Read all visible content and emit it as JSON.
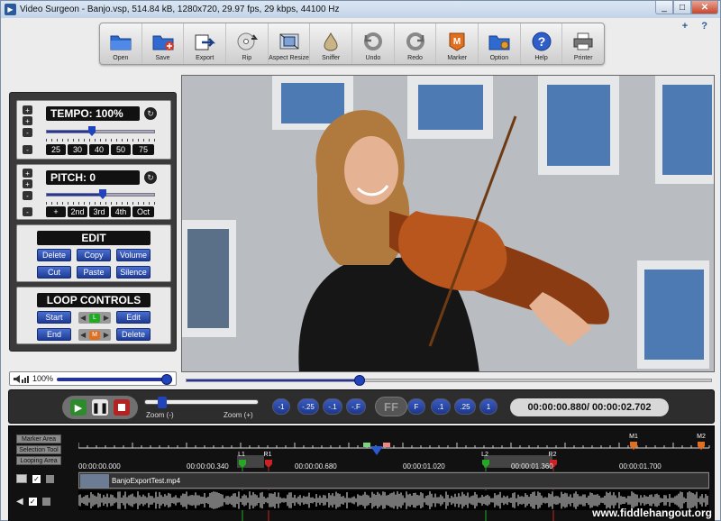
{
  "window": {
    "title": "Video Surgeon - Banjo.vsp, 514.84 kB, 1280x720, 29.97 fps, 29 kbps, 44100 Hz",
    "help_links": "+ ?"
  },
  "toolbar": {
    "items": [
      {
        "label": "Open",
        "icon": "open-folder-icon"
      },
      {
        "label": "Save",
        "icon": "save-icon"
      },
      {
        "label": "Export",
        "icon": "export-icon"
      },
      {
        "label": "Rip",
        "icon": "rip-disc-icon"
      },
      {
        "label": "Aspect Resize",
        "icon": "aspect-resize-icon"
      },
      {
        "label": "Sniffer",
        "icon": "sniffer-icon"
      },
      {
        "label": "Undo",
        "icon": "undo-icon"
      },
      {
        "label": "Redo",
        "icon": "redo-icon"
      },
      {
        "label": "Marker",
        "icon": "marker-icon"
      },
      {
        "label": "Option",
        "icon": "option-icon"
      },
      {
        "label": "Help",
        "icon": "help-icon"
      },
      {
        "label": "Printer",
        "icon": "printer-icon"
      }
    ]
  },
  "tempo": {
    "label": "TEMPO: 100%",
    "level": 0.42,
    "presets": [
      "25",
      "30",
      "40",
      "50",
      "75"
    ]
  },
  "pitch": {
    "label": "PITCH: 0",
    "level": 0.52,
    "presets": [
      "+",
      "2nd",
      "3rd",
      "4th",
      "Oct"
    ]
  },
  "edit": {
    "header": "EDIT",
    "buttons": [
      "Delete",
      "Copy",
      "Volume",
      "Cut",
      "Paste",
      "Silence"
    ]
  },
  "loop": {
    "header": "LOOP CONTROLS",
    "start": "Start",
    "end": "End",
    "edit": "Edit",
    "delete": "Delete",
    "start_mark": "L",
    "end_mark": "M"
  },
  "volume": {
    "label": "100%",
    "level": 1.0
  },
  "video": {
    "progress": 0.33
  },
  "transport": {
    "zoom_minus": "Zoom (-)",
    "zoom_plus": "Zoom (+)",
    "speeds": [
      "-1",
      "-.25",
      "-.1",
      "-.F",
      "F",
      ".1",
      ".25",
      "1"
    ],
    "ff": "FF",
    "time": "00:00:00.880/ 00:00:02.702"
  },
  "timeline": {
    "rows": [
      "Marker Area",
      "Selection Tool",
      "Looping Area"
    ],
    "markers": [
      "L1",
      "R1",
      "L2",
      "R2",
      "M1",
      "M2"
    ],
    "timecodes": [
      "00:00:00.000",
      "00:00:00.340",
      "00:00:00.680",
      "00:00:01.020",
      "00:00:01.360",
      "00:00:01.700"
    ],
    "clip_name": "BanjoExportTest.mp4",
    "watermark": "www.fiddlehangout.org"
  },
  "colors": {
    "accent": "#2244bb",
    "button": "#2a4aad",
    "loop_start": "#22aa22",
    "loop_end": "#cc2222",
    "marker": "#e07020"
  }
}
